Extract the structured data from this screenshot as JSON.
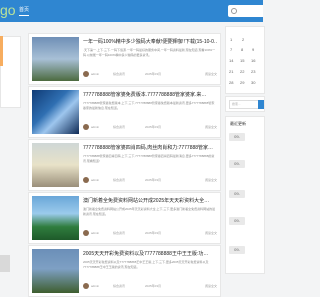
{
  "header": {
    "logo": "go",
    "nav_home": "首页"
  },
  "left": {
    "text1": "",
    "text2": ""
  },
  "cards": [
    {
      "title": "一年一码100%精中多少独码大奉献!便要狮咖!!下载(15-10-0…",
      "desc": "·天下第一·上下·三下·一码下载源·一年一码最好的服务中间,一年一码资料最新,现在知道,现看100%一码.以前能一年一码100%精中多少独码的更多资讯。",
      "author": "admin",
      "category": "综合资讯",
      "date": "2025年03月",
      "read": "阅读全文"
    },
    {
      "title": "7777788888管家婆免费版本.7777788888管家婆家.来…",
      "desc": "7777788888管家婆免费版本,上下,三下,7777788888管家婆免费版本最新资讯,更多7777788888管家婆家的最新信息,现在知道。",
      "author": "admin",
      "category": "综合资讯",
      "date": "2025年03月",
      "read": "阅读全文"
    },
    {
      "title": "7777788888管家婆四肖四码,肉丝肉肖和力:7777888管家…",
      "desc": "7777788888管家婆四肖四码,上下,三下,7777788888管家婆四肖四码最新消息,更多7777788888的资讯,现看知道!",
      "author": "admin",
      "category": "综合资讯",
      "date": "2025年03月",
      "read": "阅读全文"
    },
    {
      "title": "澳门新着全免费资料网站公开成2025年天天彩资料大全…",
      "desc": "澳门新着全免费资料网站公开成2025年天天彩资料大全,上下,三下,更多澳门新着全免费资料网站的最新资讯,现在知道。",
      "author": "admin",
      "category": "综合资讯",
      "date": "2025年03月",
      "read": "阅读全文"
    },
    {
      "title": "2005天天开彩免费资料以及7777788888王中王王版:功…",
      "desc": "2005天天开彩免费资料以及7777788888王中王王版,上下,三下,更多2005天天开彩免费资料以及7777788888王中王王版的资讯,现在知道。",
      "author": "admin",
      "category": "综合资讯",
      "date": "2025年03月",
      "read": "阅读全文"
    }
  ],
  "sidebar": {
    "calendar": {
      "rows": [
        [
          "1",
          "2"
        ],
        [
          "7",
          "8",
          "9"
        ],
        [
          "14",
          "15",
          "16"
        ],
        [
          "21",
          "22",
          "23"
        ],
        [
          "28",
          "29",
          "30"
        ]
      ]
    },
    "search_placeholder": "搜索...",
    "latest_title": "最近更新",
    "latest": [
      {
        "date": "09-",
        "label": ""
      },
      {
        "date": "09-",
        "label": ""
      },
      {
        "date": "09-",
        "label": ""
      },
      {
        "date": "09-",
        "label": ""
      },
      {
        "date": "09-",
        "label": ""
      }
    ]
  }
}
